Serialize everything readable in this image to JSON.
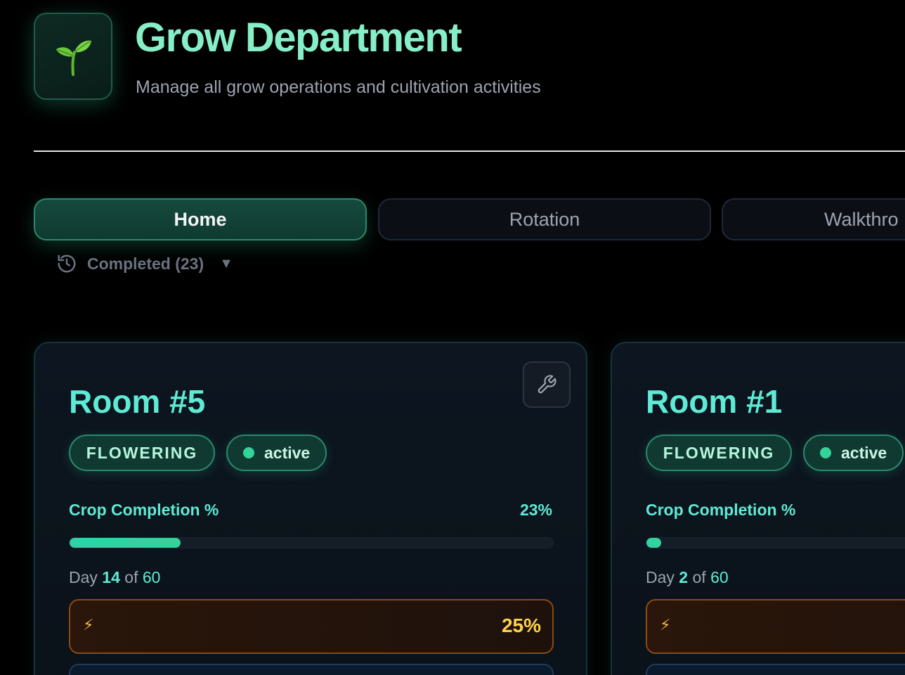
{
  "header": {
    "title": "Grow Department",
    "subtitle": "Manage all grow operations and cultivation activities",
    "icon": "seedling-icon"
  },
  "tabs": [
    {
      "label": "Home",
      "active": true
    },
    {
      "label": "Rotation",
      "active": false
    },
    {
      "label": "Walkthro",
      "active": false
    }
  ],
  "completed": {
    "label": "Completed (23)",
    "caret": "▼",
    "icon": "history-icon"
  },
  "rooms": [
    {
      "name": "Room #5",
      "stage": "FLOWERING",
      "status": "active",
      "progress_label": "Crop Completion %",
      "progress_text": "23%",
      "progress": 0.23,
      "day_prefix": "Day",
      "day": "14",
      "day_of": "of",
      "day_total": "60",
      "power_icon": "⚡",
      "power_value": "25%"
    },
    {
      "name": "Room #1",
      "stage": "FLOWERING",
      "status": "active",
      "progress_label": "Crop Completion %",
      "progress": 0.03,
      "day_prefix": "Day",
      "day": "2",
      "day_of": "of",
      "day_total": "60",
      "power_icon": "⚡"
    }
  ],
  "colors": {
    "accent": "#5eead4",
    "title": "#86efc8",
    "active_dot": "#34d399",
    "warning": "#fcd34d"
  }
}
